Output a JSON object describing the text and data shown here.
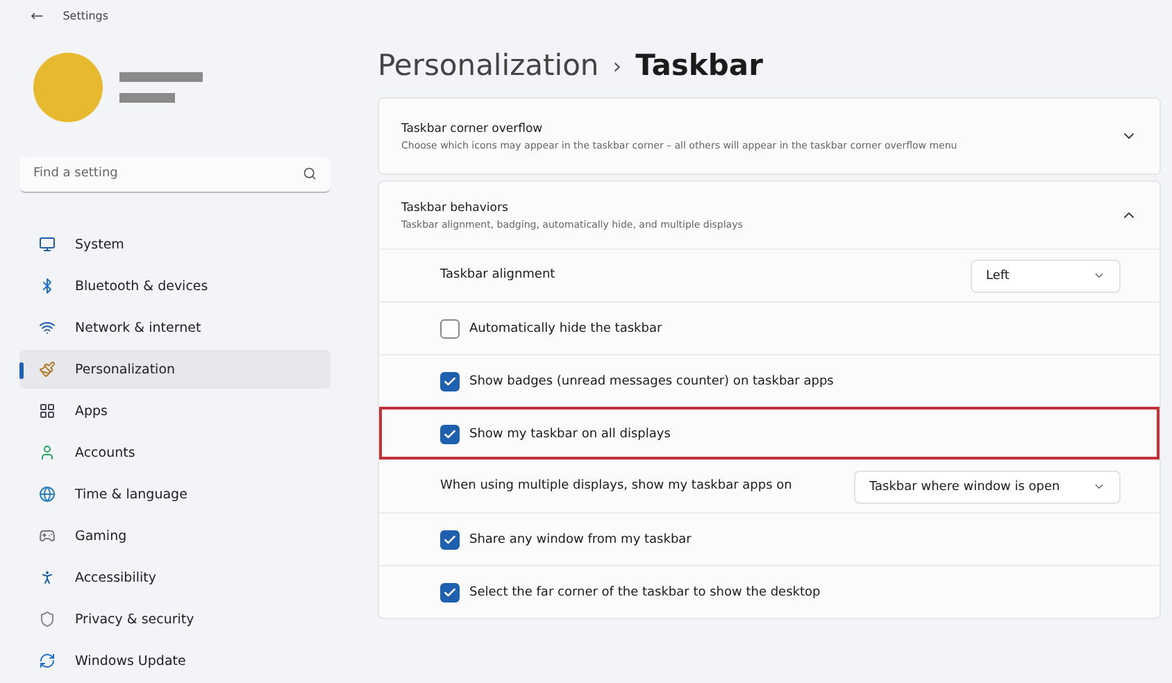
{
  "window": {
    "title": "Settings",
    "back": "←"
  },
  "search": {
    "placeholder": "Find a setting"
  },
  "sidebar": {
    "items": [
      {
        "label": "System",
        "selected": false
      },
      {
        "label": "Bluetooth & devices",
        "selected": false
      },
      {
        "label": "Network & internet",
        "selected": false
      },
      {
        "label": "Personalization",
        "selected": true
      },
      {
        "label": "Apps",
        "selected": false
      },
      {
        "label": "Accounts",
        "selected": false
      },
      {
        "label": "Time & language",
        "selected": false
      },
      {
        "label": "Gaming",
        "selected": false
      },
      {
        "label": "Accessibility",
        "selected": false
      },
      {
        "label": "Privacy & security",
        "selected": false
      },
      {
        "label": "Windows Update",
        "selected": false
      }
    ]
  },
  "breadcrumb": {
    "parent": "Personalization",
    "separator": "›",
    "current": "Taskbar"
  },
  "sections": [
    {
      "title": "Taskbar corner overflow",
      "description": "Choose which icons may appear in the taskbar corner – all others will appear in the taskbar corner overflow menu",
      "expanded": false
    },
    {
      "title": "Taskbar behaviors",
      "description": "Taskbar alignment, badging, automatically hide, and multiple displays",
      "expanded": true,
      "rows": [
        {
          "kind": "dropdown",
          "label": "Taskbar alignment",
          "value": "Left",
          "highlighted": false
        },
        {
          "kind": "checkbox",
          "label": "Automatically hide the taskbar",
          "checked": false,
          "highlighted": false
        },
        {
          "kind": "checkbox",
          "label": "Show badges (unread messages counter) on taskbar apps",
          "checked": true,
          "highlighted": false
        },
        {
          "kind": "checkbox",
          "label": "Show my taskbar on all displays",
          "checked": true,
          "highlighted": true
        },
        {
          "kind": "dropdown",
          "label": "When using multiple displays, show my taskbar apps on",
          "value": "Taskbar where window is open",
          "highlighted": false
        },
        {
          "kind": "checkbox",
          "label": "Share any window from my taskbar",
          "checked": true,
          "highlighted": false
        },
        {
          "kind": "checkbox",
          "label": "Select the far corner of the taskbar to show the desktop",
          "checked": true,
          "highlighted": false
        }
      ]
    }
  ]
}
